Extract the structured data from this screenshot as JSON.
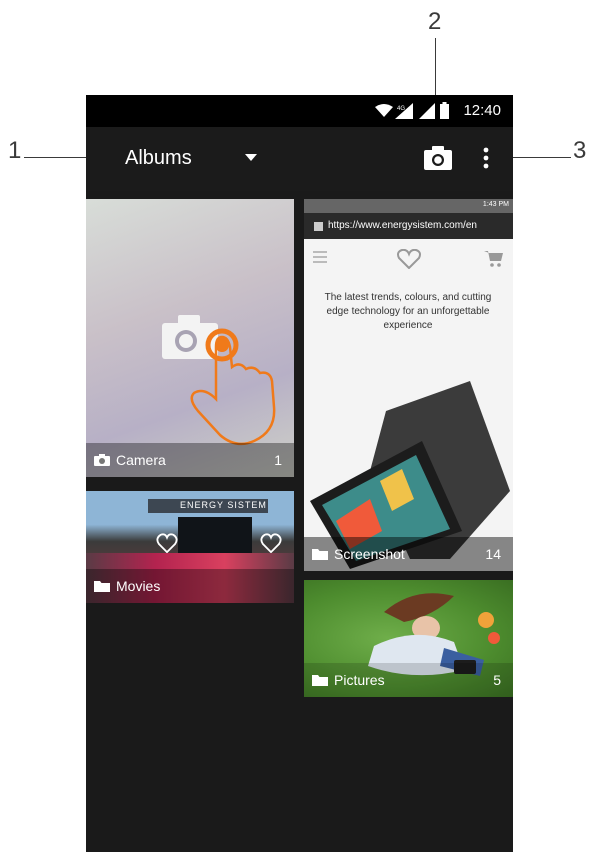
{
  "callouts": {
    "one": "1",
    "two": "2",
    "three": "3"
  },
  "status": {
    "time": "12:40",
    "network": "4G"
  },
  "toolbar": {
    "title": "Albums"
  },
  "albums": [
    {
      "name": "Camera",
      "count": "1"
    },
    {
      "name": "Movies",
      "count": ""
    },
    {
      "name": "Screenshot",
      "count": "14"
    },
    {
      "name": "Pictures",
      "count": "5"
    }
  ],
  "screenshot_preview": {
    "url": "https://www.energysistem.com/en",
    "status_time": "1:43 PM",
    "text": "The latest trends, colours, and cutting edge technology for an unforgettable experience"
  },
  "movies_banner": "ENERGY SISTEM",
  "colors": {
    "accent_orange": "#f07a1a",
    "toolbar_bg": "#1b1b1b",
    "screen_bg": "#1a1a1a"
  }
}
